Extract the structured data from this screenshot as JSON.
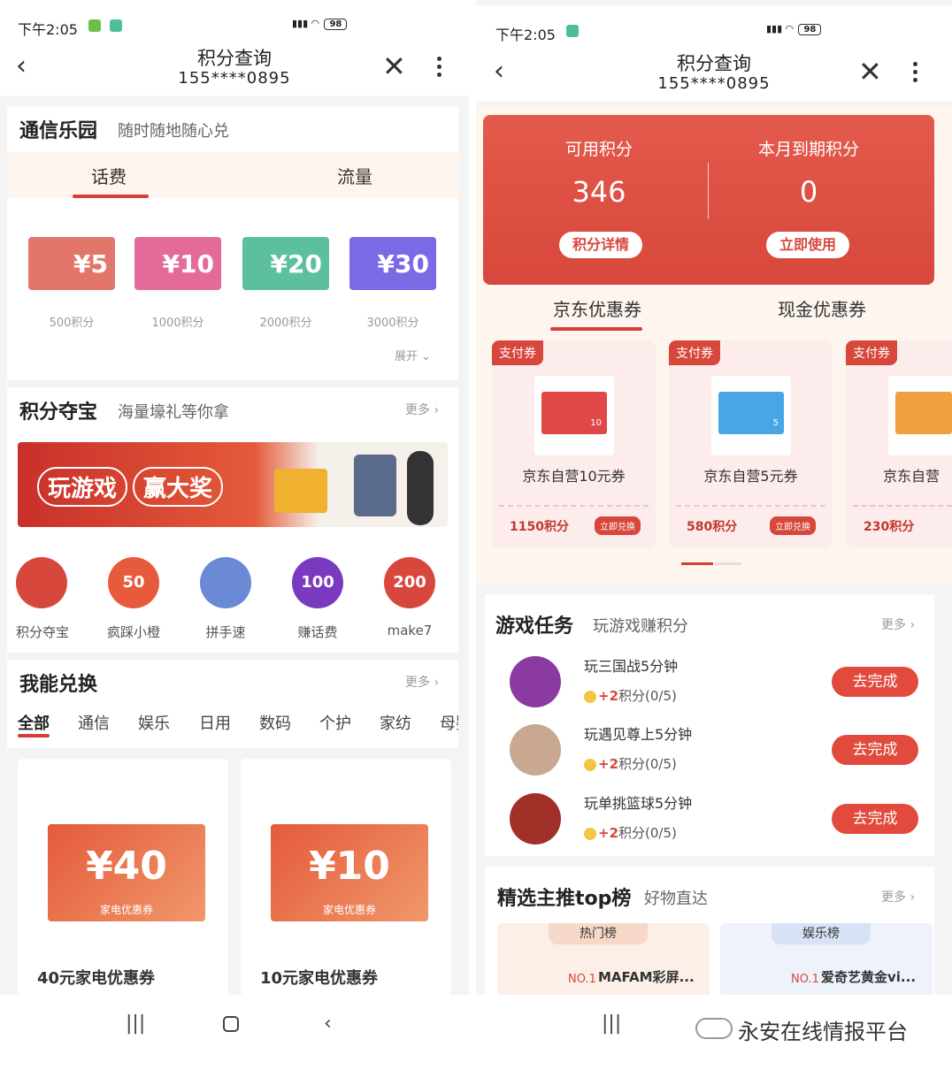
{
  "status": {
    "time": "下午2:05",
    "battery": "98"
  },
  "nav": {
    "title": "积分查询",
    "phone": "155****0895"
  },
  "left": {
    "park": {
      "title": "通信乐园",
      "subtitle": "随时随地随心兑",
      "tabs": [
        "话费",
        "流量"
      ],
      "vouchers": [
        {
          "amount": "¥5",
          "label": "500积分",
          "color": "#e2766a"
        },
        {
          "amount": "¥10",
          "label": "1000积分",
          "color": "#e46a9a"
        },
        {
          "amount": "¥20",
          "label": "2000积分",
          "color": "#5cc0a0"
        },
        {
          "amount": "¥30",
          "label": "3000积分",
          "color": "#7a6ae6"
        }
      ],
      "expand": "展开"
    },
    "treasure": {
      "title": "积分夺宝",
      "subtitle": "海量壕礼等你拿",
      "more": "更多",
      "banner": [
        "玩游戏",
        "赢大奖"
      ],
      "icons": [
        {
          "label": "积分夺宝",
          "badge": ""
        },
        {
          "label": "疯踩小橙",
          "badge": "50"
        },
        {
          "label": "拼手速",
          "badge": ""
        },
        {
          "label": "赚话费",
          "badge": "100"
        },
        {
          "label": "make7",
          "badge": "200"
        }
      ]
    },
    "exchange": {
      "title": "我能兑换",
      "more": "更多",
      "cats": [
        "全部",
        "通信",
        "娱乐",
        "日用",
        "数码",
        "个护",
        "家纺",
        "母婴"
      ],
      "products": [
        {
          "amount": "¥40",
          "tag": "家电优惠券",
          "name": "40元家电优惠券"
        },
        {
          "amount": "¥10",
          "tag": "家电优惠券",
          "name": "10元家电优惠券"
        }
      ]
    }
  },
  "right": {
    "points": {
      "available_label": "可用积分",
      "available": "346",
      "expiring_label": "本月到期积分",
      "expiring": "0",
      "detail_btn": "积分详情",
      "use_btn": "立即使用"
    },
    "coupon_tabs": [
      "京东优惠券",
      "现金优惠券"
    ],
    "coupons": [
      {
        "tag": "支付券",
        "name": "京东自营10元券",
        "points": "1150积分",
        "btn": "立即兑换",
        "color": "#e04848",
        "value": "10"
      },
      {
        "tag": "支付券",
        "name": "京东自营5元券",
        "points": "580积分",
        "btn": "立即兑换",
        "color": "#49a6e6",
        "value": "5"
      },
      {
        "tag": "支付券",
        "name": "京东自营",
        "points": "230积分",
        "btn": "",
        "color": "#f0a040",
        "value": ""
      }
    ],
    "games": {
      "title": "游戏任务",
      "subtitle": "玩游戏赚积分",
      "more": "更多",
      "items": [
        {
          "name": "玩三国战5分钟",
          "reward": "+2",
          "pts": "积分(0/5)",
          "btn": "去完成",
          "color": "#8a3aa0"
        },
        {
          "name": "玩遇见尊上5分钟",
          "reward": "+2",
          "pts": "积分(0/5)",
          "btn": "去完成",
          "color": "#c8a890"
        },
        {
          "name": "玩单挑篮球5分钟",
          "reward": "+2",
          "pts": "积分(0/5)",
          "btn": "去完成",
          "color": "#a03028"
        }
      ]
    },
    "top": {
      "title": "精选主推top榜",
      "subtitle": "好物直达",
      "more": "更多",
      "boards": [
        {
          "label": "热门榜",
          "rank": "NO.1",
          "name": "MAFAM彩屏..."
        },
        {
          "label": "娱乐榜",
          "rank": "NO.1",
          "name": "爱奇艺黄金vi..."
        }
      ]
    }
  },
  "watermark": "永安在线情报平台"
}
